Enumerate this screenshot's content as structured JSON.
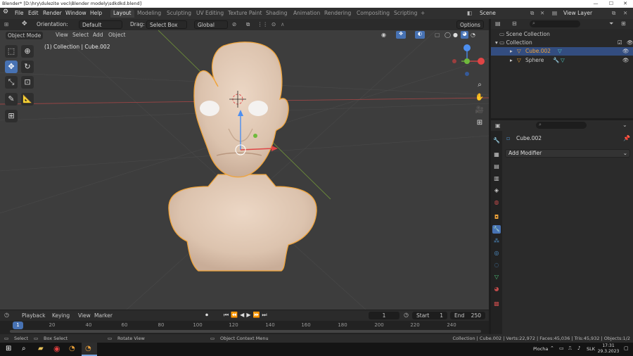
{
  "window": {
    "title": "Blender* [D:\\hry\\dulezite veci\\Blender modely\\sdkdkd.blend]",
    "minimize": "—",
    "maximize": "☐",
    "close": "✕"
  },
  "top_menu": {
    "items": [
      "File",
      "Edit",
      "Render",
      "Window",
      "Help"
    ],
    "workspaces": [
      "Layout",
      "Modeling",
      "Sculpting",
      "UV Editing",
      "Texture Paint",
      "Shading",
      "Animation",
      "Rendering",
      "Compositing",
      "Scripting"
    ],
    "active_workspace": "Layout",
    "add_workspace": "+",
    "scene_label": "Scene",
    "view_layer_label": "View Layer"
  },
  "viewport_header": {
    "mode": "Object Mode",
    "menus": [
      "View",
      "Select",
      "Add",
      "Object"
    ],
    "orientation_label": "Orientation:",
    "orientation_value": "Default",
    "drag_label": "Drag:",
    "drag_value": "Select Box",
    "transform_space": "Global",
    "options_label": "Options"
  },
  "viewport": {
    "info_text": "(1) Collection | Cube.002",
    "background": "#3d3d3d",
    "mesh_color": "#e9d2bf",
    "selection_outline": "#f0a43a",
    "gizmo_labels": {
      "y": "Y",
      "x": "X",
      "z": "Z"
    }
  },
  "outliner": {
    "search_placeholder": "",
    "root": "Scene Collection",
    "collection": "Collection",
    "objects": [
      {
        "name": "Cube.002",
        "selected": true
      },
      {
        "name": "Sphere",
        "selected": false
      }
    ]
  },
  "properties": {
    "object_name": "Cube.002",
    "add_modifier": "Add Modifier"
  },
  "timeline": {
    "menus": [
      "Playback",
      "Keying",
      "View",
      "Marker"
    ],
    "current_frame": "1",
    "start_label": "Start",
    "start_value": "1",
    "end_label": "End",
    "end_value": "250",
    "ticks": [
      "1",
      "20",
      "40",
      "60",
      "80",
      "100",
      "120",
      "140",
      "160",
      "180",
      "200",
      "220",
      "240"
    ]
  },
  "status_bar": {
    "select": "Select",
    "box_select": "Box Select",
    "rotate_view": "Rotate View",
    "context_menu": "Object Context Menu",
    "stats": "Collection | Cube.002 | Verts:22,972 | Faces:45,036 | Tris:45,932 | Objects:1/2"
  },
  "taskbar": {
    "desktop_label": "Plocha",
    "language": "SLK",
    "time": "17:31",
    "date": "29.3.2023"
  }
}
